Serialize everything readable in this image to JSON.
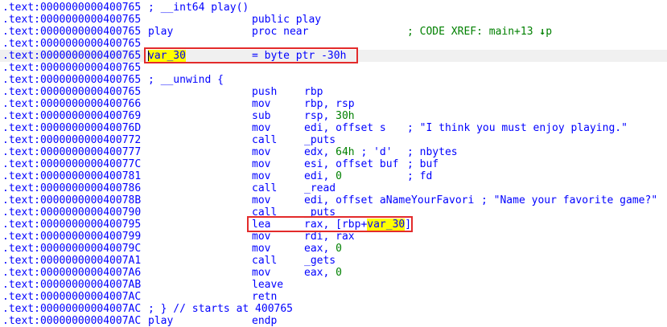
{
  "lines": [
    {
      "addr": ".text:0000000000400765",
      "comment": "; __int64 play()"
    },
    {
      "addr": ".text:0000000000400765",
      "mnemonic": "public play"
    },
    {
      "addr": ".text:0000000000400765",
      "label": "play",
      "mnemonic": "proc near",
      "xref": "; CODE XREF: main+13",
      "xref_arrow": "↓",
      "xref_tail": "p"
    },
    {
      "addr": ".text:0000000000400765"
    },
    {
      "addr": ".text:0000000000400765",
      "label": "var_30",
      "var_def": "= byte ptr -30h"
    },
    {
      "addr": ".text:0000000000400765"
    },
    {
      "addr": ".text:0000000000400765",
      "comment": "; __unwind {"
    },
    {
      "addr": ".text:0000000000400765",
      "mnemonic": "push",
      "operand": "rbp"
    },
    {
      "addr": ".text:0000000000400766",
      "mnemonic": "mov",
      "operand": "rbp, rsp"
    },
    {
      "addr": ".text:0000000000400769",
      "mnemonic": "sub",
      "operand_pre": "rsp, ",
      "operand_num": "30h"
    },
    {
      "addr": ".text:000000000040076D",
      "mnemonic": "mov",
      "operand": "edi, offset s",
      "trail": "; \"I think you must enjoy playing.\""
    },
    {
      "addr": ".text:0000000000400772",
      "mnemonic": "call",
      "operand": "_puts"
    },
    {
      "addr": ".text:0000000000400777",
      "mnemonic": "mov",
      "operand_pre": "edx, ",
      "operand_num": "64h",
      "operand_post": " ; 'd'",
      "trail": "; nbytes"
    },
    {
      "addr": ".text:000000000040077C",
      "mnemonic": "mov",
      "operand": "esi, offset buf",
      "trail": "; buf"
    },
    {
      "addr": ".text:0000000000400781",
      "mnemonic": "mov",
      "operand_pre": "edi, ",
      "operand_num": "0",
      "trail": "; fd"
    },
    {
      "addr": ".text:0000000000400786",
      "mnemonic": "call",
      "operand": "_read"
    },
    {
      "addr": ".text:000000000040078B",
      "mnemonic": "mov",
      "operand": "edi, offset aNameYourFavori",
      "trail": "; \"Name your favorite game?\""
    },
    {
      "addr": ".text:0000000000400790",
      "mnemonic": "call",
      "operand": "_puts"
    },
    {
      "addr": ".text:0000000000400795",
      "mnemonic": "lea",
      "operand_pre": "rax, [rbp+",
      "operand_var": "var_30",
      "operand_post": "]"
    },
    {
      "addr": ".text:0000000000400799",
      "mnemonic": "mov",
      "operand": "rdi, rax"
    },
    {
      "addr": ".text:000000000040079C",
      "mnemonic": "mov",
      "operand_pre": "eax, ",
      "operand_num": "0"
    },
    {
      "addr": ".text:00000000004007A1",
      "mnemonic": "call",
      "operand": "_gets"
    },
    {
      "addr": ".text:00000000004007A6",
      "mnemonic": "mov",
      "operand_pre": "eax, ",
      "operand_num": "0"
    },
    {
      "addr": ".text:00000000004007AB",
      "mnemonic": "leave"
    },
    {
      "addr": ".text:00000000004007AC",
      "mnemonic": "retn"
    },
    {
      "addr": ".text:00000000004007AC",
      "comment": "; } // starts at 400765"
    },
    {
      "addr": ".text:00000000004007AC",
      "label": "play",
      "mnemonic": "endp"
    }
  ],
  "colors": {
    "address": "#0000ff",
    "code": "#0000ff",
    "number": "#008000",
    "highlight": "#ffff00",
    "annotation_box": "#e32b2b"
  }
}
